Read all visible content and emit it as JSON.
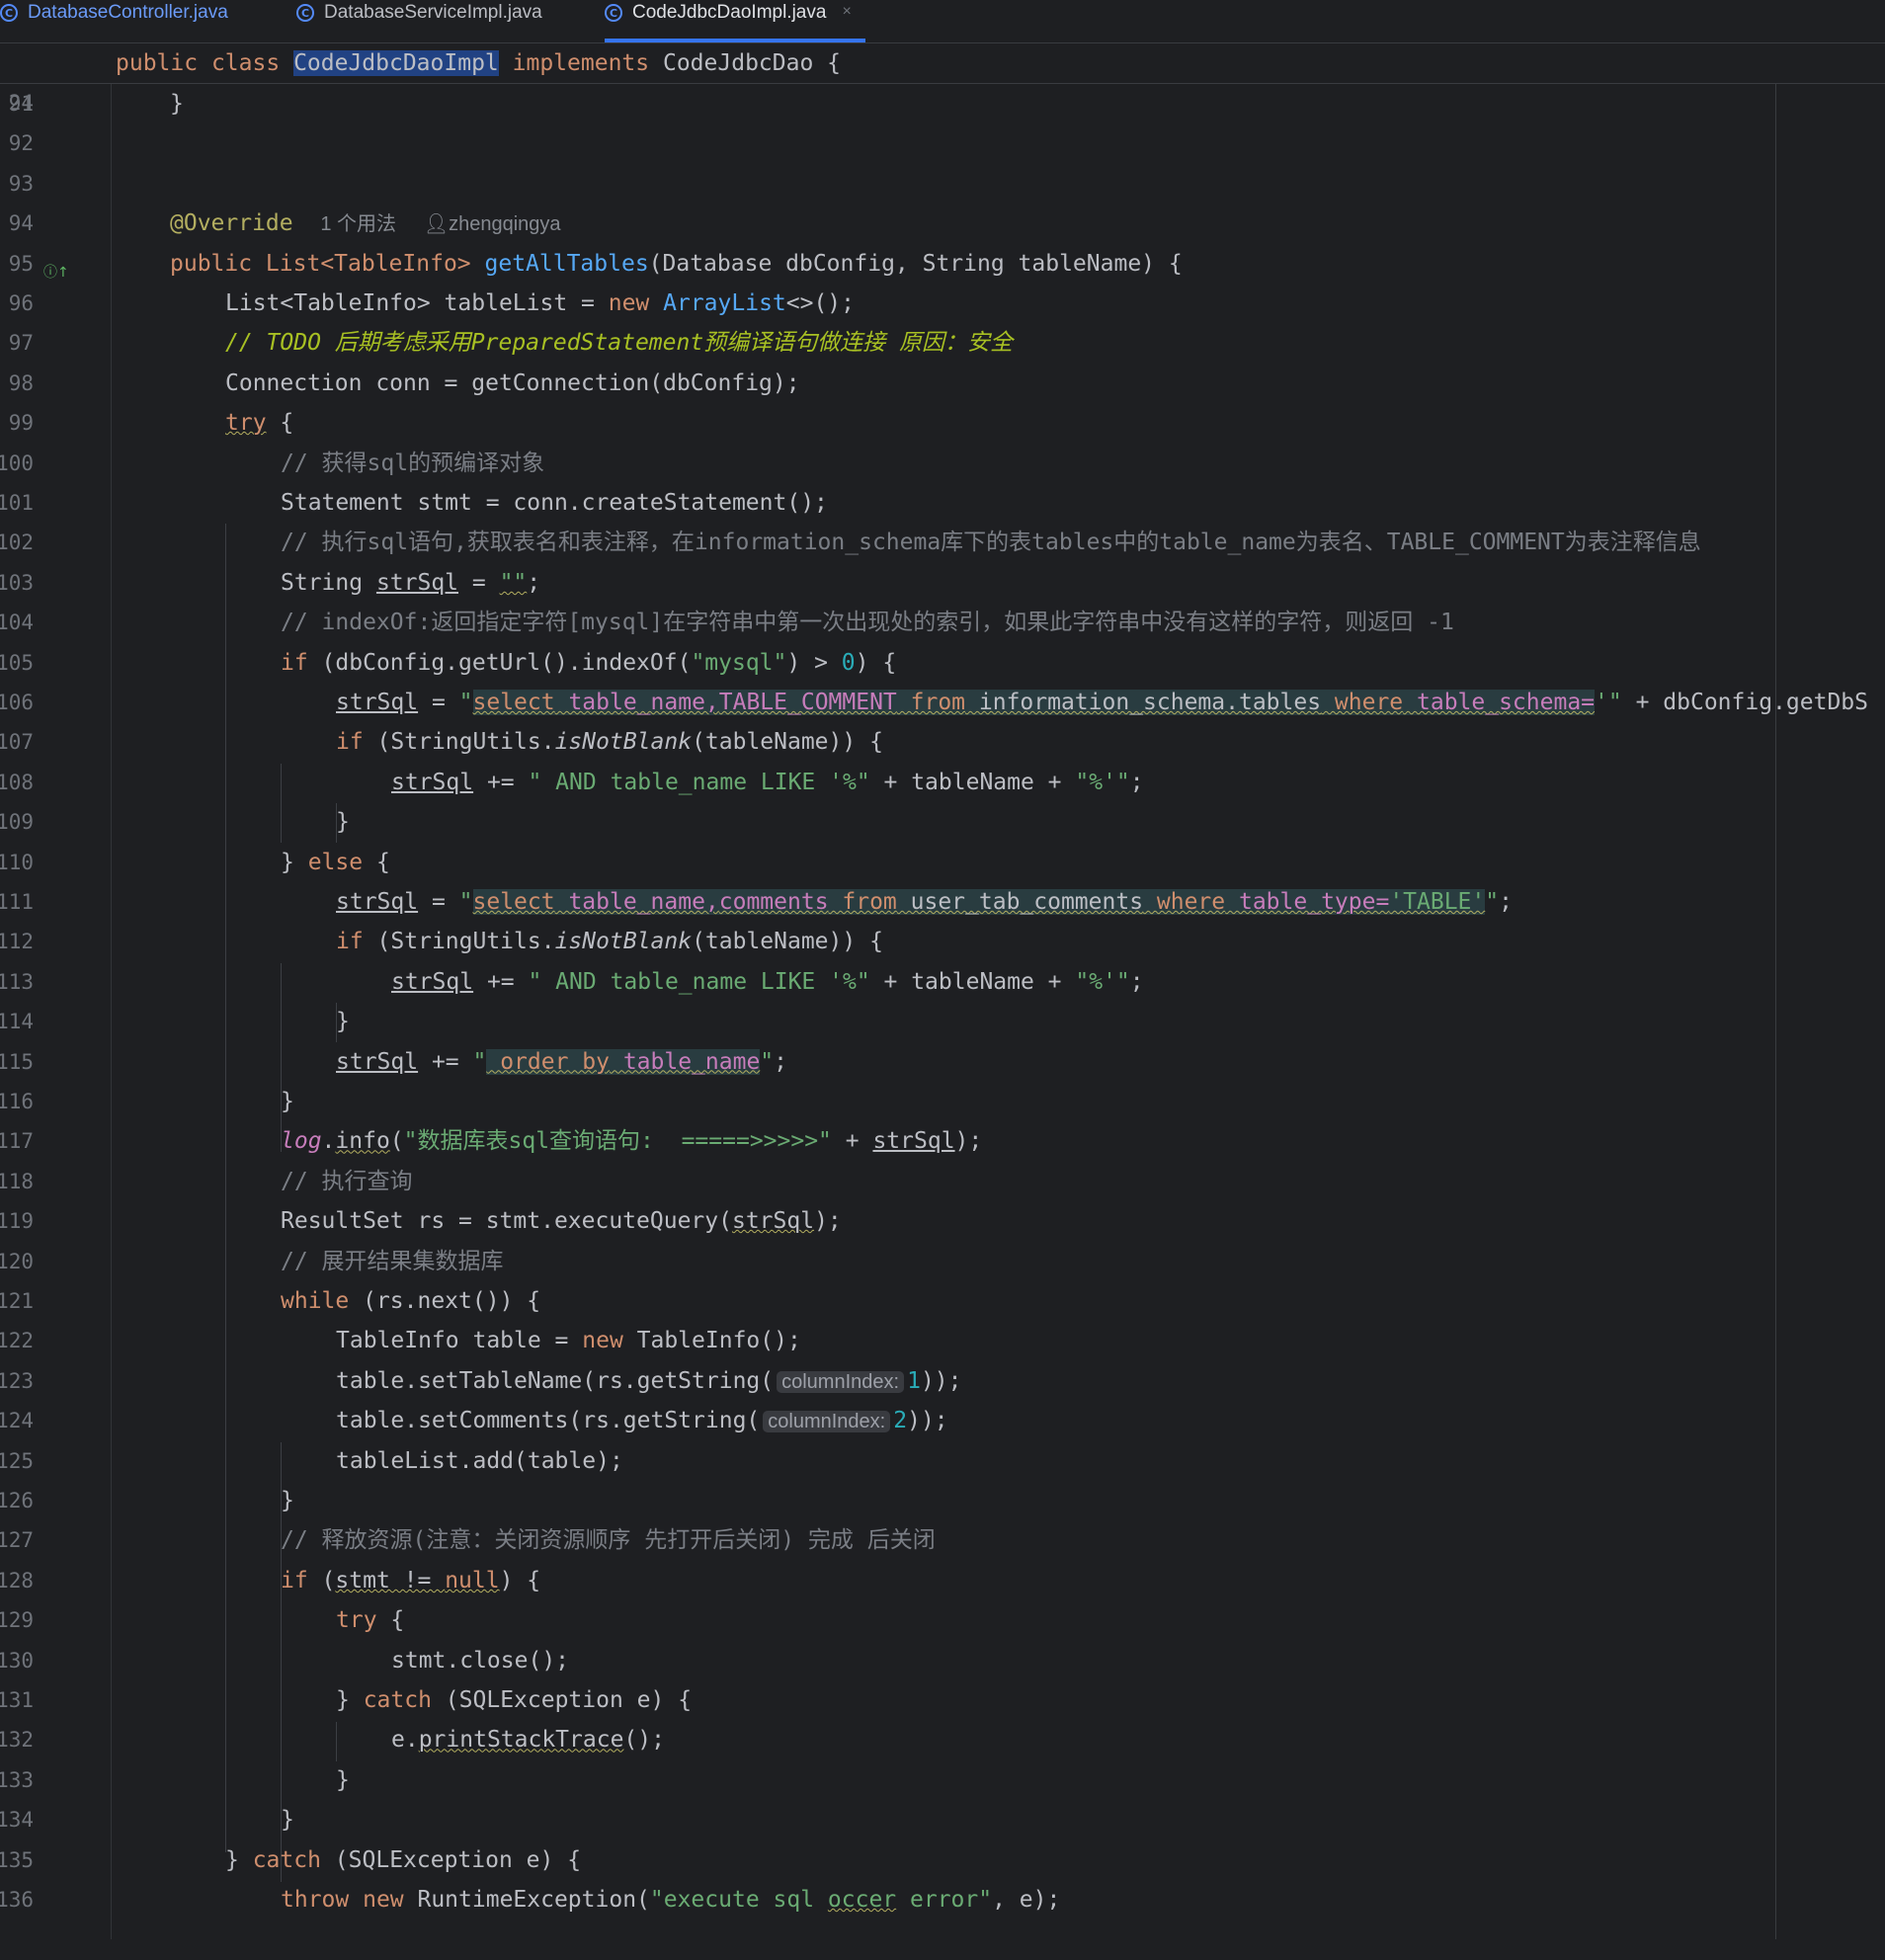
{
  "tabs": [
    {
      "label": "DatabaseController.java",
      "icon": "class-icon"
    },
    {
      "label": "DatabaseServiceImpl.java",
      "icon": "class-icon"
    },
    {
      "label": "CodeJdbcDaoImpl.java",
      "icon": "class-icon",
      "active": true,
      "close": "×"
    }
  ],
  "sticky": {
    "line_number": "24",
    "kw_public": "public",
    "kw_class": "class",
    "class_name": "CodeJdbcDaoImpl",
    "kw_implements": "implements",
    "iface": "CodeJdbcDao {"
  },
  "lines": [
    {
      "n": "91"
    },
    {
      "n": "92"
    },
    {
      "n": "93"
    },
    {
      "n": "94"
    },
    {
      "n": "95"
    },
    {
      "n": "96"
    },
    {
      "n": "97"
    },
    {
      "n": "98"
    },
    {
      "n": "99"
    },
    {
      "n": "100"
    },
    {
      "n": "101"
    },
    {
      "n": "102"
    },
    {
      "n": "103"
    },
    {
      "n": "104"
    },
    {
      "n": "105"
    },
    {
      "n": "106"
    },
    {
      "n": "107"
    },
    {
      "n": "108"
    },
    {
      "n": "109"
    },
    {
      "n": "110"
    },
    {
      "n": "111"
    },
    {
      "n": "112"
    },
    {
      "n": "113"
    },
    {
      "n": "114"
    },
    {
      "n": "115"
    },
    {
      "n": "116"
    },
    {
      "n": "117"
    },
    {
      "n": "118"
    },
    {
      "n": "119"
    },
    {
      "n": "120"
    },
    {
      "n": "121"
    },
    {
      "n": "122"
    },
    {
      "n": "123"
    },
    {
      "n": "124"
    },
    {
      "n": "125"
    },
    {
      "n": "126"
    },
    {
      "n": "127"
    },
    {
      "n": "128"
    },
    {
      "n": "129"
    },
    {
      "n": "130"
    },
    {
      "n": "131"
    },
    {
      "n": "132"
    },
    {
      "n": "133"
    },
    {
      "n": "134"
    },
    {
      "n": "135"
    },
    {
      "n": "136"
    }
  ],
  "code": {
    "l91": "}",
    "l94_ann": "@Override",
    "l94_usages": "1 个用法",
    "l94_author": "zhengqingya",
    "l95_a": "public List<TableInfo> ",
    "l95_m": "getAllTables",
    "l95_b": "(Database dbConfig, String tableName) {",
    "l96_a": "List<TableInfo> tableList = ",
    "l96_new": "new",
    "l96_cls": "ArrayList",
    "l96_b": "<>();",
    "l97_c": "// ",
    "l97_todo": "TODO 后期考虑采用PreparedStatement预编译语句做连接 原因：安全",
    "l98": "Connection conn = getConnection(dbConfig);",
    "l99_try": "try",
    "l99_b": " {",
    "l100": "// 获得sql的预编译对象",
    "l101": "Statement stmt = conn.createStatement();",
    "l102": "// 执行sql语句,获取表名和表注释，在information_schema库下的表tables中的table_name为表名、TABLE_COMMENT为表注释信息",
    "l103_a": "String ",
    "l103_v": "strSql",
    "l103_b": " = ",
    "l103_s": "\"\"",
    "l103_c": ";",
    "l104": "// indexOf:返回指定字符[mysql]在字符串中第一次出现处的索引，如果此字符串中没有这样的字符，则返回 -1",
    "l105_if": "if",
    "l105_a": " (dbConfig.getUrl().indexOf(",
    "l105_s": "\"mysql\"",
    "l105_b": ") > ",
    "l105_n": "0",
    "l105_c": ") {",
    "l106_v": "strSql",
    "l106_a": " = ",
    "l106_q1": "\"",
    "l106_sel": "select",
    "l106_t1": " table_name,",
    "l106_tc": "TABLE_COMMENT",
    "l106_from": " from",
    "l106_t2": " information_schema.tables",
    "l106_where": " where",
    "l106_t3": " table_schema=",
    "l106_q2": "'\"",
    "l106_b": " + dbConfig.getDbS",
    "l107_if": "if",
    "l107_a": " (StringUtils.",
    "l107_m": "isNotBlank",
    "l107_b": "(tableName)) {",
    "l108_v": "strSql",
    "l108_a": " += ",
    "l108_s1": "\" AND table_name LIKE '%\"",
    "l108_b": " + tableName + ",
    "l108_s2": "\"%'\"",
    "l108_c": ";",
    "l109": "}",
    "l110_a": "} ",
    "l110_else": "else",
    "l110_b": " {",
    "l111_v": "strSql",
    "l111_a": " = ",
    "l111_q1": "\"",
    "l111_sel": "select",
    "l111_t1": " table_name,",
    "l111_t1b": "comments",
    "l111_from": " from",
    "l111_t2": " user_tab_comments",
    "l111_where": " where",
    "l111_t3": " table_type=",
    "l111_lit": "'TABLE'",
    "l111_q2": "\"",
    "l111_c": ";",
    "l112_if": "if",
    "l112_a": " (StringUtils.",
    "l112_m": "isNotBlank",
    "l112_b": "(tableName)) {",
    "l113_v": "strSql",
    "l113_a": " += ",
    "l113_s1": "\" AND table_name LIKE '%\"",
    "l113_b": " + tableName + ",
    "l113_s2": "\"%'\"",
    "l113_c": ";",
    "l114": "}",
    "l115_v": "strSql",
    "l115_a": " += ",
    "l115_q1": "\"",
    "l115_order": " order by",
    "l115_t": " table_name",
    "l115_q2": "\"",
    "l115_c": ";",
    "l116": "}",
    "l117_log": "log",
    "l117_a": ".",
    "l117_info": "info",
    "l117_b": "(",
    "l117_s": "\"数据库表sql查询语句:  =====>>>>>\"",
    "l117_c": " + ",
    "l117_v": "strSql",
    "l117_d": ");",
    "l118": "// 执行查询",
    "l119_a": "ResultSet rs = stmt.executeQuery(",
    "l119_v": "strSql",
    "l119_b": ");",
    "l120": "// 展开结果集数据库",
    "l121_while": "while",
    "l121_a": " (rs.next()) {",
    "l122_a": "TableInfo table = ",
    "l122_new": "new",
    "l122_b": " TableInfo();",
    "l123_a": "table.setTableName(rs.getString(",
    "l123_hint": "columnIndex:",
    "l123_n": "1",
    "l123_b": "));",
    "l124_a": "table.setComments(rs.getString(",
    "l124_hint": "columnIndex:",
    "l124_n": "2",
    "l124_b": "));",
    "l125": "tableList.add(table);",
    "l126": "}",
    "l127": "// 释放资源(注意：关闭资源顺序 先打开后关闭) 完成 后关闭",
    "l128_if": "if",
    "l128_a": " (",
    "l128_w": "stmt != ",
    "l128_null": "null",
    "l128_b": ") {",
    "l129_try": "try",
    "l129_b": " {",
    "l130": "stmt.close();",
    "l131_a": "} ",
    "l131_catch": "catch",
    "l131_b": " (SQLException e) {",
    "l132_a": "e.",
    "l132_w": "printStackTrace",
    "l132_b": "();",
    "l133": "}",
    "l134": "}",
    "l135_a": "} ",
    "l135_catch": "catch",
    "l135_b": " (SQLException e) {",
    "l136_throw": "throw",
    "l136_new": " new",
    "l136_a": " RuntimeException(",
    "l136_s1": "\"execute sql ",
    "l136_w": "occer",
    "l136_s2": " error\"",
    "l136_b": ", e);"
  },
  "colors": {
    "background": "#1e1f22",
    "keyword": "#cf8e6d",
    "method": "#56a8f5",
    "string": "#6aab73",
    "number": "#2aacb8",
    "comment": "#7a7e85",
    "todo": "#a8c023",
    "annotation": "#b3ae60",
    "tab_accent": "#3574f0"
  }
}
